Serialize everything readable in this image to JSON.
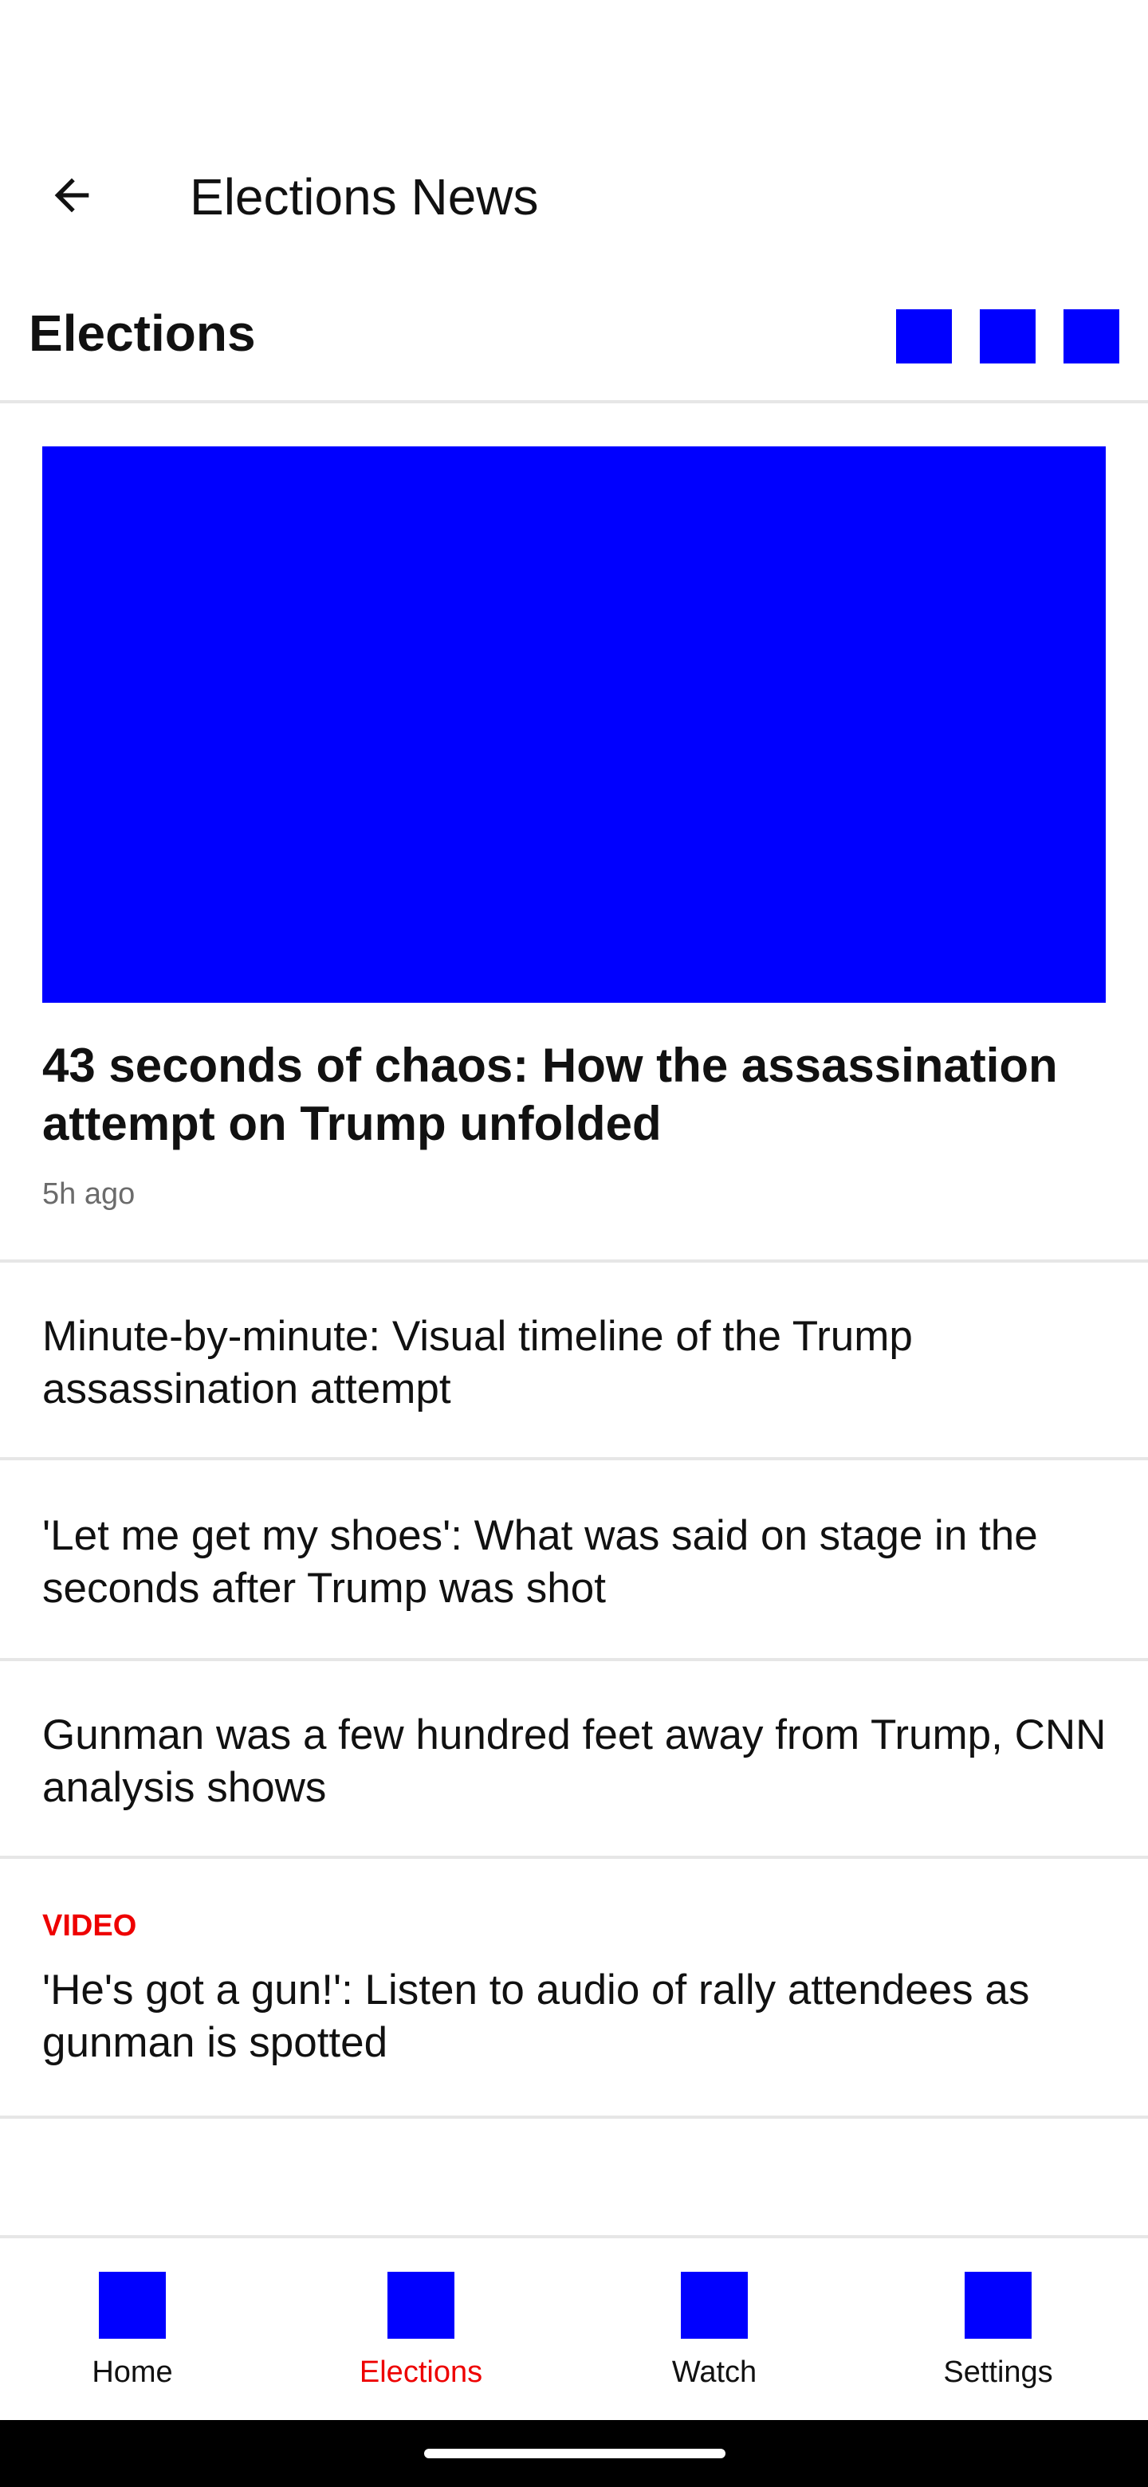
{
  "app_bar": {
    "title": "Elections News",
    "back_icon": "arrow-left-icon"
  },
  "section": {
    "title": "Elections",
    "icons": [
      "action-icon-1",
      "action-icon-2",
      "action-icon-3"
    ],
    "icon_color": "#0000ff"
  },
  "hero": {
    "title": "43 seconds of chaos: How the assassination attempt on Trump unfolded",
    "time": "5h ago",
    "image_color": "#0000ff"
  },
  "stories": [
    {
      "kicker": "",
      "text": "Minute-by-minute: Visual timeline of the Trump assassination attempt"
    },
    {
      "kicker": "",
      "text": "'Let me get my shoes': What was said on stage in the seconds after Trump was shot"
    },
    {
      "kicker": "",
      "text": "Gunman was a few hundred feet away from Trump, CNN analysis shows"
    },
    {
      "kicker": "VIDEO",
      "text": "'He's got a gun!': Listen to audio of rally attendees as gunman is spotted"
    }
  ],
  "bottom_nav": {
    "items": [
      {
        "label": "Home",
        "icon": "home-icon",
        "active": false
      },
      {
        "label": "Elections",
        "icon": "elections-icon",
        "active": true
      },
      {
        "label": "Watch",
        "icon": "watch-icon",
        "active": false
      },
      {
        "label": "Settings",
        "icon": "settings-icon",
        "active": false
      }
    ],
    "active_color": "#ee0000"
  }
}
